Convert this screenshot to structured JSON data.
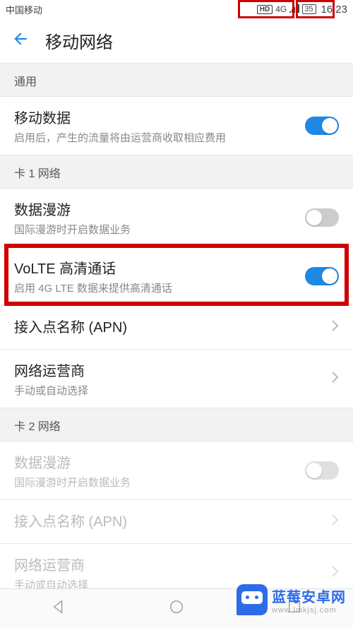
{
  "status_bar": {
    "carrier": "中国移动",
    "hd": "HD",
    "net": "4G",
    "battery": "35",
    "time": "16:23"
  },
  "header": {
    "title": "移动网络"
  },
  "sections": {
    "general_label": "通用",
    "sim1_label": "卡 1 网络",
    "sim2_label": "卡 2 网络"
  },
  "rows": {
    "mobile_data": {
      "title": "移动数据",
      "sub": "启用后，产生的流量将由运营商收取相应费用"
    },
    "roam1": {
      "title": "数据漫游",
      "sub": "国际漫游时开启数据业务"
    },
    "volte": {
      "title": "VoLTE 高清通话",
      "sub": "启用 4G LTE 数据来提供高清通话"
    },
    "apn1": {
      "title": "接入点名称 (APN)"
    },
    "carrier1": {
      "title": "网络运营商",
      "sub": "手动或自动选择"
    },
    "roam2": {
      "title": "数据漫游",
      "sub": "国际漫游时开启数据业务"
    },
    "apn2": {
      "title": "接入点名称 (APN)"
    },
    "carrier2": {
      "title": "网络运营商",
      "sub": "手动或自动选择"
    }
  },
  "watermark": {
    "brand": "蓝莓安卓网",
    "url": "www.lmkjsj.com"
  }
}
